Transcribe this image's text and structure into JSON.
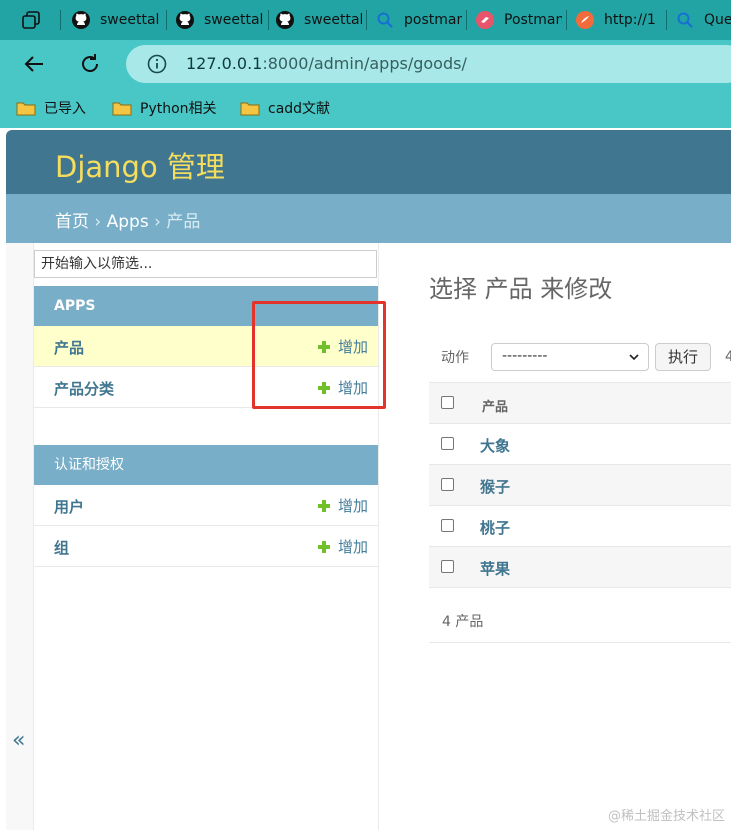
{
  "browser": {
    "tabs": [
      {
        "label": "",
        "icon": "collections-icon"
      },
      {
        "label": "sweettal",
        "icon": "github-icon"
      },
      {
        "label": "sweettal",
        "icon": "github-icon"
      },
      {
        "label": "sweettal",
        "icon": "github-icon"
      },
      {
        "label": "postman",
        "icon": "search-icon"
      },
      {
        "label": "Postman",
        "icon": "postman-icon"
      },
      {
        "label": "http://1",
        "icon": "orange-circle-icon"
      },
      {
        "label": "Que",
        "icon": "search-icon"
      }
    ],
    "url_host": "127.0.0.1",
    "url_rest": ":8000/admin/apps/goods/",
    "bookmarks": [
      {
        "label": "已导入"
      },
      {
        "label": "Python相关"
      },
      {
        "label": "cadd文献"
      }
    ]
  },
  "admin": {
    "brand": "Django 管理",
    "breadcrumbs": {
      "home": "首页",
      "app": "Apps",
      "current": "产品",
      "sep": "›"
    },
    "sidebar_toggle": "«",
    "filter_placeholder": "开始输入以筛选...",
    "modules": [
      {
        "caption": "APPS",
        "models": [
          {
            "name": "产品",
            "add_label": "增加",
            "selected": true
          },
          {
            "name": "产品分类",
            "add_label": "增加",
            "selected": false
          }
        ]
      },
      {
        "caption": "认证和授权",
        "models": [
          {
            "name": "用户",
            "add_label": "增加",
            "selected": false
          },
          {
            "name": "组",
            "add_label": "增加",
            "selected": false
          }
        ]
      }
    ],
    "content": {
      "title": "选择 产品 来修改",
      "action_label": "动作",
      "action_value": "---------",
      "go_button": "执行",
      "selection_count": "4",
      "column_header": "产品",
      "rows": [
        "大象",
        "猴子",
        "桃子",
        "苹果"
      ],
      "paginator": "4 产品"
    },
    "colors": {
      "header": "#417690",
      "breadcrumbs": "#79aec8",
      "brand_text": "#f5dd5d",
      "link": "#417690",
      "add_icon": "#70bf2b",
      "selected_row": "#ffffcc",
      "annotation": "#e2342b"
    }
  },
  "watermark": "@稀土掘金技术社区"
}
